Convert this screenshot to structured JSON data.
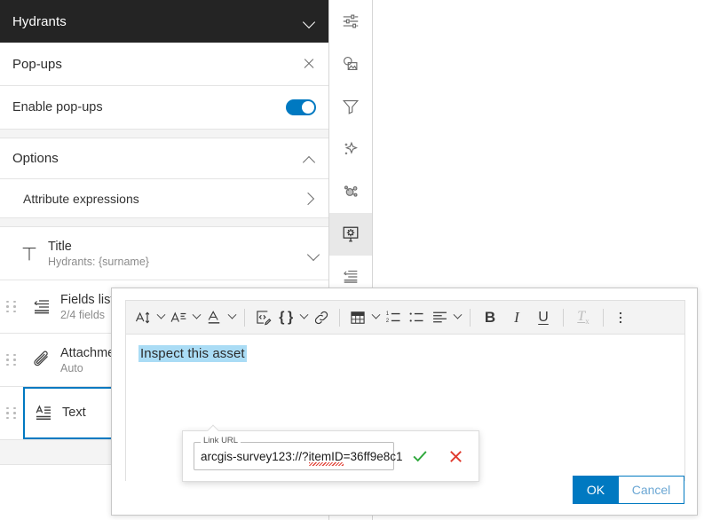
{
  "panel": {
    "layer_title": "Hydrants",
    "section_title": "Pop-ups",
    "enable_label": "Enable pop-ups",
    "options_label": "Options",
    "attribute_expressions_label": "Attribute expressions",
    "blocks": [
      {
        "name": "Title",
        "sub": "Hydrants: {surname}",
        "icon": "title-icon"
      },
      {
        "name": "Fields list",
        "sub": "2/4 fields",
        "icon": "fields-list-icon"
      },
      {
        "name": "Attachments",
        "sub": "Auto",
        "icon": "paperclip-icon"
      },
      {
        "name": "Text",
        "sub": "",
        "icon": "text-icon"
      }
    ]
  },
  "rail": {
    "items": [
      {
        "name": "properties-icon",
        "label": "Properties"
      },
      {
        "name": "styles-icon",
        "label": "Styles"
      },
      {
        "name": "filter-icon",
        "label": "Filter"
      },
      {
        "name": "effects-icon",
        "label": "Effects"
      },
      {
        "name": "aggregation-icon",
        "label": "Aggregation"
      },
      {
        "name": "configure-popups-icon",
        "label": "Configure pop-ups"
      },
      {
        "name": "fields-icon",
        "label": "Fields"
      }
    ],
    "active_index": 5
  },
  "editor": {
    "toolbar": [
      {
        "name": "font-size-button",
        "label": "AI",
        "caret": true
      },
      {
        "name": "paragraph-style-button",
        "label": "A",
        "caret": true
      },
      {
        "name": "text-color-button",
        "label": "A",
        "caret": true
      },
      {
        "name": "source-code-button",
        "label": "",
        "caret": false
      },
      {
        "name": "field-expression-button",
        "label": "{ }",
        "caret": true
      },
      {
        "name": "link-button",
        "label": "",
        "caret": false
      },
      {
        "name": "table-button",
        "label": "",
        "caret": true
      },
      {
        "name": "numbered-list-button",
        "label": "",
        "caret": false
      },
      {
        "name": "bulleted-list-button",
        "label": "",
        "caret": false
      },
      {
        "name": "align-button",
        "label": "",
        "caret": true
      },
      {
        "name": "bold-button",
        "label": "B",
        "caret": false
      },
      {
        "name": "italic-button",
        "label": "I",
        "caret": false
      },
      {
        "name": "underline-button",
        "label": "U",
        "caret": false
      },
      {
        "name": "clear-format-button",
        "label": "Tx",
        "caret": false
      },
      {
        "name": "more-options-button",
        "label": "",
        "caret": false
      }
    ],
    "content_text": "Inspect this asset",
    "link_popup": {
      "field_label": "Link URL",
      "field_value": "arcgis-survey123://?itemID=36ff9e8c1",
      "value_prefix": "arcgis-survey123://?",
      "value_misspelled": "itemID",
      "value_suffix": "=36ff9e8c1",
      "confirm_label": "confirm",
      "cancel_label": "cancel"
    },
    "ok_label": "OK",
    "cancel_label": "Cancel"
  },
  "colors": {
    "accent": "#0079c1",
    "header_bg": "#242424",
    "selection_highlight": "#aadcf5",
    "confirm_green": "#2fa83c",
    "cancel_red": "#e03b2f"
  }
}
